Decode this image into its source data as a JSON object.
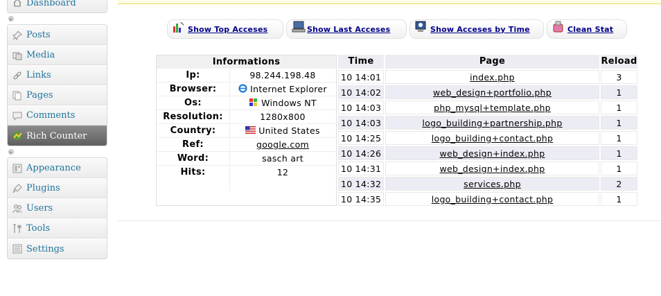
{
  "sidebar": {
    "group1": [
      {
        "label": "Dashboard",
        "icon": "dashboard-icon"
      }
    ],
    "group2": [
      {
        "label": "Posts",
        "icon": "pushpin-icon"
      },
      {
        "label": "Media",
        "icon": "media-icon"
      },
      {
        "label": "Links",
        "icon": "link-icon"
      },
      {
        "label": "Pages",
        "icon": "pages-icon"
      },
      {
        "label": "Comments",
        "icon": "comment-icon"
      },
      {
        "label": "Rich Counter",
        "icon": "counter-icon",
        "active": true
      }
    ],
    "group3": [
      {
        "label": "Appearance",
        "icon": "appearance-icon"
      },
      {
        "label": "Plugins",
        "icon": "plugin-icon"
      },
      {
        "label": "Users",
        "icon": "users-icon"
      },
      {
        "label": "Tools",
        "icon": "tools-icon"
      },
      {
        "label": "Settings",
        "icon": "settings-icon"
      }
    ]
  },
  "buttons": {
    "top_acceses": "Show Top Acceses",
    "last_acceses": "Show Last Acceses",
    "acceses_by_time": "Show Acceses by Time",
    "clean_stat": "Clean Stat"
  },
  "info": {
    "title": "Informations",
    "rows": [
      {
        "key": "Ip:",
        "value": "98.244.198.48"
      },
      {
        "key": "Browser:",
        "value": "Internet Explorer",
        "icon": "ie-browser-icon"
      },
      {
        "key": "Os:",
        "value": "Windows NT",
        "icon": "windows-icon"
      },
      {
        "key": "Resolution:",
        "value": "1280x800"
      },
      {
        "key": "Country:",
        "value": "United States",
        "icon": "us-flag-icon"
      },
      {
        "key": "Ref:",
        "value": "google.com",
        "link": true
      },
      {
        "key": "Word:",
        "value": "sasch art"
      },
      {
        "key": "Hits:",
        "value": "12"
      }
    ]
  },
  "access": {
    "headers": {
      "time": "Time",
      "page": "Page",
      "reload": "Reload"
    },
    "rows": [
      {
        "time": "10 14:01",
        "page": "index.php",
        "reload": "3"
      },
      {
        "time": "10 14:02",
        "page": "web_design+portfolio.php",
        "reload": "1"
      },
      {
        "time": "10 14:03",
        "page": "php_mysql+template.php",
        "reload": "1"
      },
      {
        "time": "10 14:03",
        "page": "logo_building+partnership.php",
        "reload": "1"
      },
      {
        "time": "10 14:25",
        "page": "logo_building+contact.php",
        "reload": "1"
      },
      {
        "time": "10 14:26",
        "page": "web_design+index.php",
        "reload": "1"
      },
      {
        "time": "10 14:31",
        "page": "web_design+index.php",
        "reload": "1"
      },
      {
        "time": "10 14:32",
        "page": "services.php",
        "reload": "2"
      },
      {
        "time": "10 14:35",
        "page": "logo_building+contact.php",
        "reload": "1"
      }
    ]
  },
  "colors": {
    "link": "#21759b",
    "button_text": "#000088",
    "active_menu": "#6d6d6d"
  }
}
